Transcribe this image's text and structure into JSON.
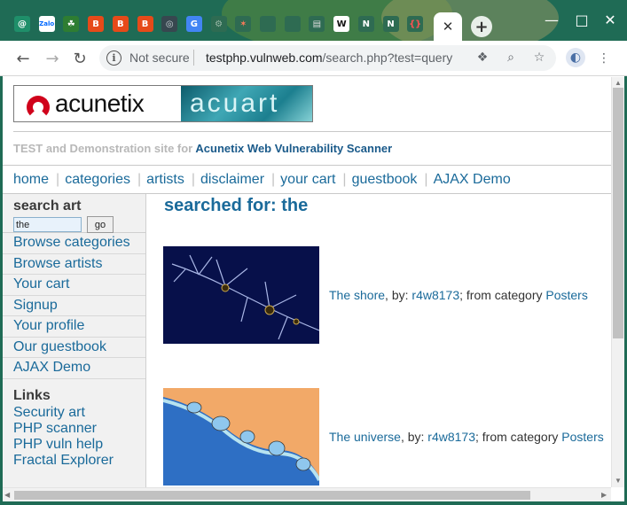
{
  "browser": {
    "tabs": [
      {
        "icon": "at-sign-icon",
        "glyph": "@",
        "bg": "#1f8f6a",
        "fg": "#ffffff"
      },
      {
        "icon": "zalo-icon",
        "glyph": "Zalo",
        "bg": "#ffffff",
        "fg": "#0068ff"
      },
      {
        "icon": "leaf-icon",
        "glyph": "☘",
        "bg": "#2e7d32",
        "fg": "#ffffff"
      },
      {
        "icon": "burp-icon",
        "glyph": "B",
        "bg": "#e64a19",
        "fg": "#ffffff"
      },
      {
        "icon": "burp-icon",
        "glyph": "B",
        "bg": "#e64a19",
        "fg": "#ffffff"
      },
      {
        "icon": "burp-icon",
        "glyph": "B",
        "bg": "#e64a19",
        "fg": "#ffffff"
      },
      {
        "icon": "globe-icon",
        "glyph": "◎",
        "bg": "#37474f",
        "fg": "#cfd8dc"
      },
      {
        "icon": "google-translate-icon",
        "glyph": "G",
        "bg": "#4285f4",
        "fg": "#ffffff"
      },
      {
        "icon": "gear-icon",
        "glyph": "⚙",
        "bg": "#2e6b52",
        "fg": "#9bb8a8"
      },
      {
        "icon": "hubspot-icon",
        "glyph": "✶",
        "bg": "#2e6b52",
        "fg": "#ff7a59"
      },
      {
        "icon": "blank-tab-icon",
        "glyph": "",
        "bg": "#2e6b52",
        "fg": "#9bb8a8"
      },
      {
        "icon": "blank-tab-icon",
        "glyph": "",
        "bg": "#2e6b52",
        "fg": "#9bb8a8"
      },
      {
        "icon": "document-icon",
        "glyph": "▤",
        "bg": "#2e6b52",
        "fg": "#dddddd"
      },
      {
        "icon": "wikipedia-icon",
        "glyph": "W",
        "bg": "#ffffff",
        "fg": "#111111"
      },
      {
        "icon": "notion-icon",
        "glyph": "N",
        "bg": "#2e6b52",
        "fg": "#ffffff"
      },
      {
        "icon": "notion-icon",
        "glyph": "N",
        "bg": "#2e6b52",
        "fg": "#ffffff"
      },
      {
        "icon": "braces-icon",
        "glyph": "{}",
        "bg": "#2e6b52",
        "fg": "#ff5252"
      }
    ],
    "active_tab_close": "✕",
    "new_tab": "+",
    "window": {
      "minimize": "—",
      "maximize": "□",
      "close": "✕"
    },
    "nav": {
      "back": "←",
      "forward": "→",
      "reload": "↻"
    },
    "address": {
      "security_label": "Not secure",
      "host": "testphp.vulnweb.com",
      "path": "/search.php?test=query"
    },
    "toolbar_icons": {
      "extension": "❖",
      "zoom": "⌕",
      "bookmark": "☆",
      "profile": "◐",
      "menu": "⋮"
    }
  },
  "site": {
    "logo": {
      "brand": "acunetix",
      "product": "acuart"
    },
    "tagline": {
      "prefix": "TEST and Demonstration site for",
      "link": "Acunetix Web Vulnerability Scanner"
    },
    "topnav": [
      "home",
      "categories",
      "artists",
      "disclaimer",
      "your cart",
      "guestbook",
      "AJAX Demo"
    ],
    "search": {
      "heading": "search art",
      "value": "the",
      "button": "go"
    },
    "sidebar_menu": [
      "Browse categories",
      "Browse artists",
      "Your cart",
      "Signup",
      "Your profile",
      "Our guestbook",
      "AJAX Demo"
    ],
    "links": {
      "heading": "Links",
      "items": [
        "Security art",
        "PHP scanner",
        "PHP vuln help",
        "Fractal Explorer"
      ]
    },
    "results_title": "searched for: the",
    "results": [
      {
        "title": "The shore",
        "by_label": ", by:",
        "artist": "r4w8173",
        "cat_label": "; from category",
        "category": "Posters"
      },
      {
        "title": "The universe",
        "by_label": ", by:",
        "artist": "r4w8173",
        "cat_label": "; from category",
        "category": "Posters"
      }
    ]
  }
}
